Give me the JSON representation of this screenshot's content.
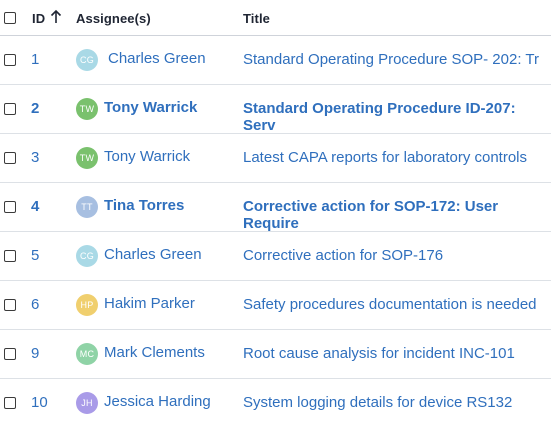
{
  "header": {
    "id_label": "ID",
    "sort_icon": "arrow-up-icon",
    "assignee_label": "Assignee(s)",
    "title_label": "Title"
  },
  "colors": {
    "link": "#2f6fbd",
    "avatar_cg": "#a9d9e6",
    "avatar_tw": "#7ac16d",
    "avatar_tt": "#a7bfe1",
    "avatar_hp": "#f0cf6e",
    "avatar_mc": "#8fd3a6",
    "avatar_jh": "#a99be8"
  },
  "rows": [
    {
      "id": "1",
      "initials": "CG",
      "assignee": "Charles Green",
      "title": "Standard Operating Procedure SOP- 202: Tr",
      "bold": false
    },
    {
      "id": "2",
      "initials": "TW",
      "assignee": "Tony Warrick",
      "title": "Standard Operating Procedure ID-207: Serv",
      "bold": true
    },
    {
      "id": "3",
      "initials": "TW",
      "assignee": "Tony Warrick",
      "title": "Latest CAPA reports for laboratory controls",
      "bold": false
    },
    {
      "id": "4",
      "initials": "TT",
      "assignee": "Tina Torres",
      "title": "Corrective action for SOP-172: User Require",
      "bold": true
    },
    {
      "id": "5",
      "initials": "CG",
      "assignee": "Charles Green",
      "title": "Corrective action for SOP-176",
      "bold": false
    },
    {
      "id": "6",
      "initials": "HP",
      "assignee": "Hakim Parker",
      "title": "Safety procedures documentation is needed",
      "bold": false
    },
    {
      "id": "9",
      "initials": "MC",
      "assignee": "Mark Clements",
      "title": "Root cause analysis for incident INC-101",
      "bold": false
    },
    {
      "id": "10",
      "initials": "JH",
      "assignee": "Jessica Harding",
      "title": "System logging details for device RS132",
      "bold": false
    }
  ]
}
